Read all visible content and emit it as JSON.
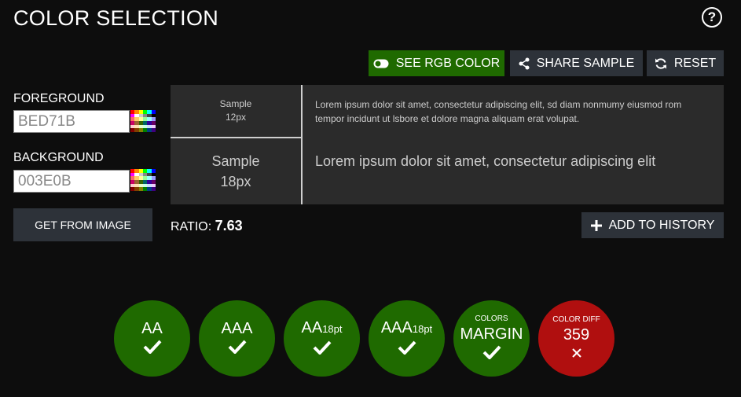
{
  "header": {
    "title": "COLOR SELECTION",
    "help_glyph": "?"
  },
  "toolbar": {
    "rgb_label": "SEE RGB COLOR",
    "share_label": "SHARE SAMPLE",
    "reset_label": "RESET"
  },
  "colors": {
    "foreground": {
      "label": "FOREGROUND",
      "value": "BED71B"
    },
    "background": {
      "label": "BACKGROUND",
      "value": "003E0B"
    },
    "get_from_image_label": "GET FROM IMAGE",
    "accent_green": "#1f6a00",
    "fail_red": "#b00f0f",
    "button_gray": "#2d3239"
  },
  "preview": {
    "small_sample_line1": "Sample",
    "small_sample_line2": "12px",
    "large_sample_line1": "Sample",
    "large_sample_line2": "18px",
    "small_text": "Lorem ipsum dolor sit amet, consectetur adipiscing elit, sd diam nonmumy eiusmod rom tempor incidunt ut lsbore et dolore magna aliquam erat volupat.",
    "large_text": "Lorem ipsum dolor sit amet, consectetur adipiscing elit"
  },
  "ratio": {
    "label": "RATIO:",
    "value": "7.63"
  },
  "history": {
    "add_label": "ADD TO HISTORY"
  },
  "badges": {
    "aa": {
      "main": "AA",
      "status": "pass"
    },
    "aaa": {
      "main": "AAA",
      "status": "pass"
    },
    "aa18": {
      "main": "AA",
      "sub": "18pt",
      "status": "pass"
    },
    "aaa18": {
      "main": "AAA",
      "sub": "18pt",
      "status": "pass"
    },
    "margin": {
      "top": "COLORS",
      "main": "MARGIN",
      "status": "pass"
    },
    "diff": {
      "top": "COLOR DIFF",
      "main": "359",
      "status": "fail"
    }
  },
  "icons": {
    "help": "question-circle-icon",
    "rgb": "toggle-icon",
    "share": "share-icon",
    "reset": "refresh-icon",
    "palette": "palette-icon",
    "add": "plus-icon",
    "pass": "check-icon",
    "fail": "x-icon"
  }
}
